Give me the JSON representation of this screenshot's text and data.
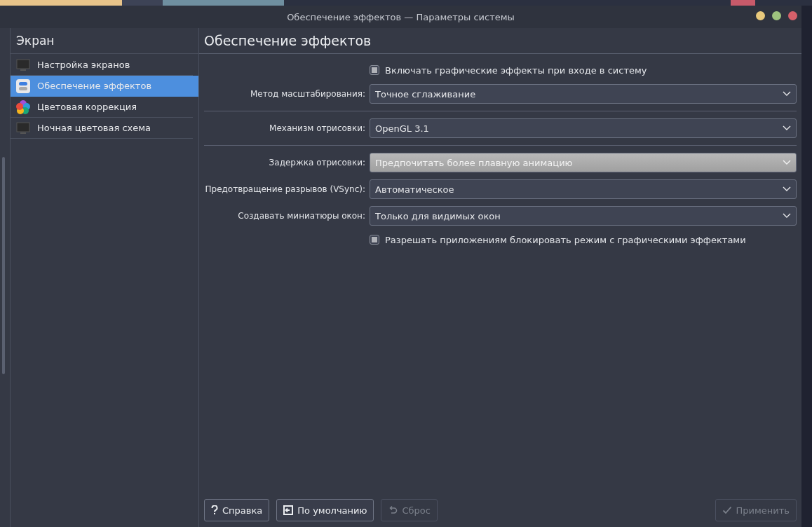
{
  "window": {
    "title": "Обеспечение эффектов — Параметры системы"
  },
  "sidebar": {
    "title": "Экран",
    "items": [
      {
        "label": "Настройка экранов",
        "selected": false
      },
      {
        "label": "Обеспечение эффектов",
        "selected": true
      },
      {
        "label": "Цветовая коррекция",
        "selected": false
      },
      {
        "label": "Ночная цветовая схема",
        "selected": false
      }
    ]
  },
  "page": {
    "title": "Обеспечение эффектов",
    "rows": [
      {
        "kind": "checkbox",
        "label": "Включать графические эффекты при входе в систему",
        "checked": true
      },
      {
        "kind": "select",
        "label": "Метод масштабирования:",
        "value": "Точное сглаживание",
        "highlighted": false
      },
      {
        "kind": "separator"
      },
      {
        "kind": "select",
        "label": "Механизм отрисовки:",
        "value": "OpenGL 3.1",
        "highlighted": false
      },
      {
        "kind": "separator"
      },
      {
        "kind": "select",
        "label": "Задержка отрисовки:",
        "value": "Предпочитать более плавную анимацию",
        "highlighted": true
      },
      {
        "kind": "select",
        "label": "Предотвращение разрывов (VSync):",
        "value": "Автоматическое",
        "highlighted": false
      },
      {
        "kind": "select",
        "label": "Создавать миниатюры окон:",
        "value": "Только для видимых окон",
        "highlighted": false
      },
      {
        "kind": "checkbox",
        "label": "Разрешать приложениям блокировать режим с графическими эффектами",
        "checked": true
      }
    ]
  },
  "buttons": [
    {
      "label": "Справка",
      "disabled": false
    },
    {
      "label": "По умолчанию",
      "disabled": false
    },
    {
      "label": "Сброс",
      "disabled": true
    },
    {
      "label": "Применить",
      "disabled": true
    }
  ]
}
